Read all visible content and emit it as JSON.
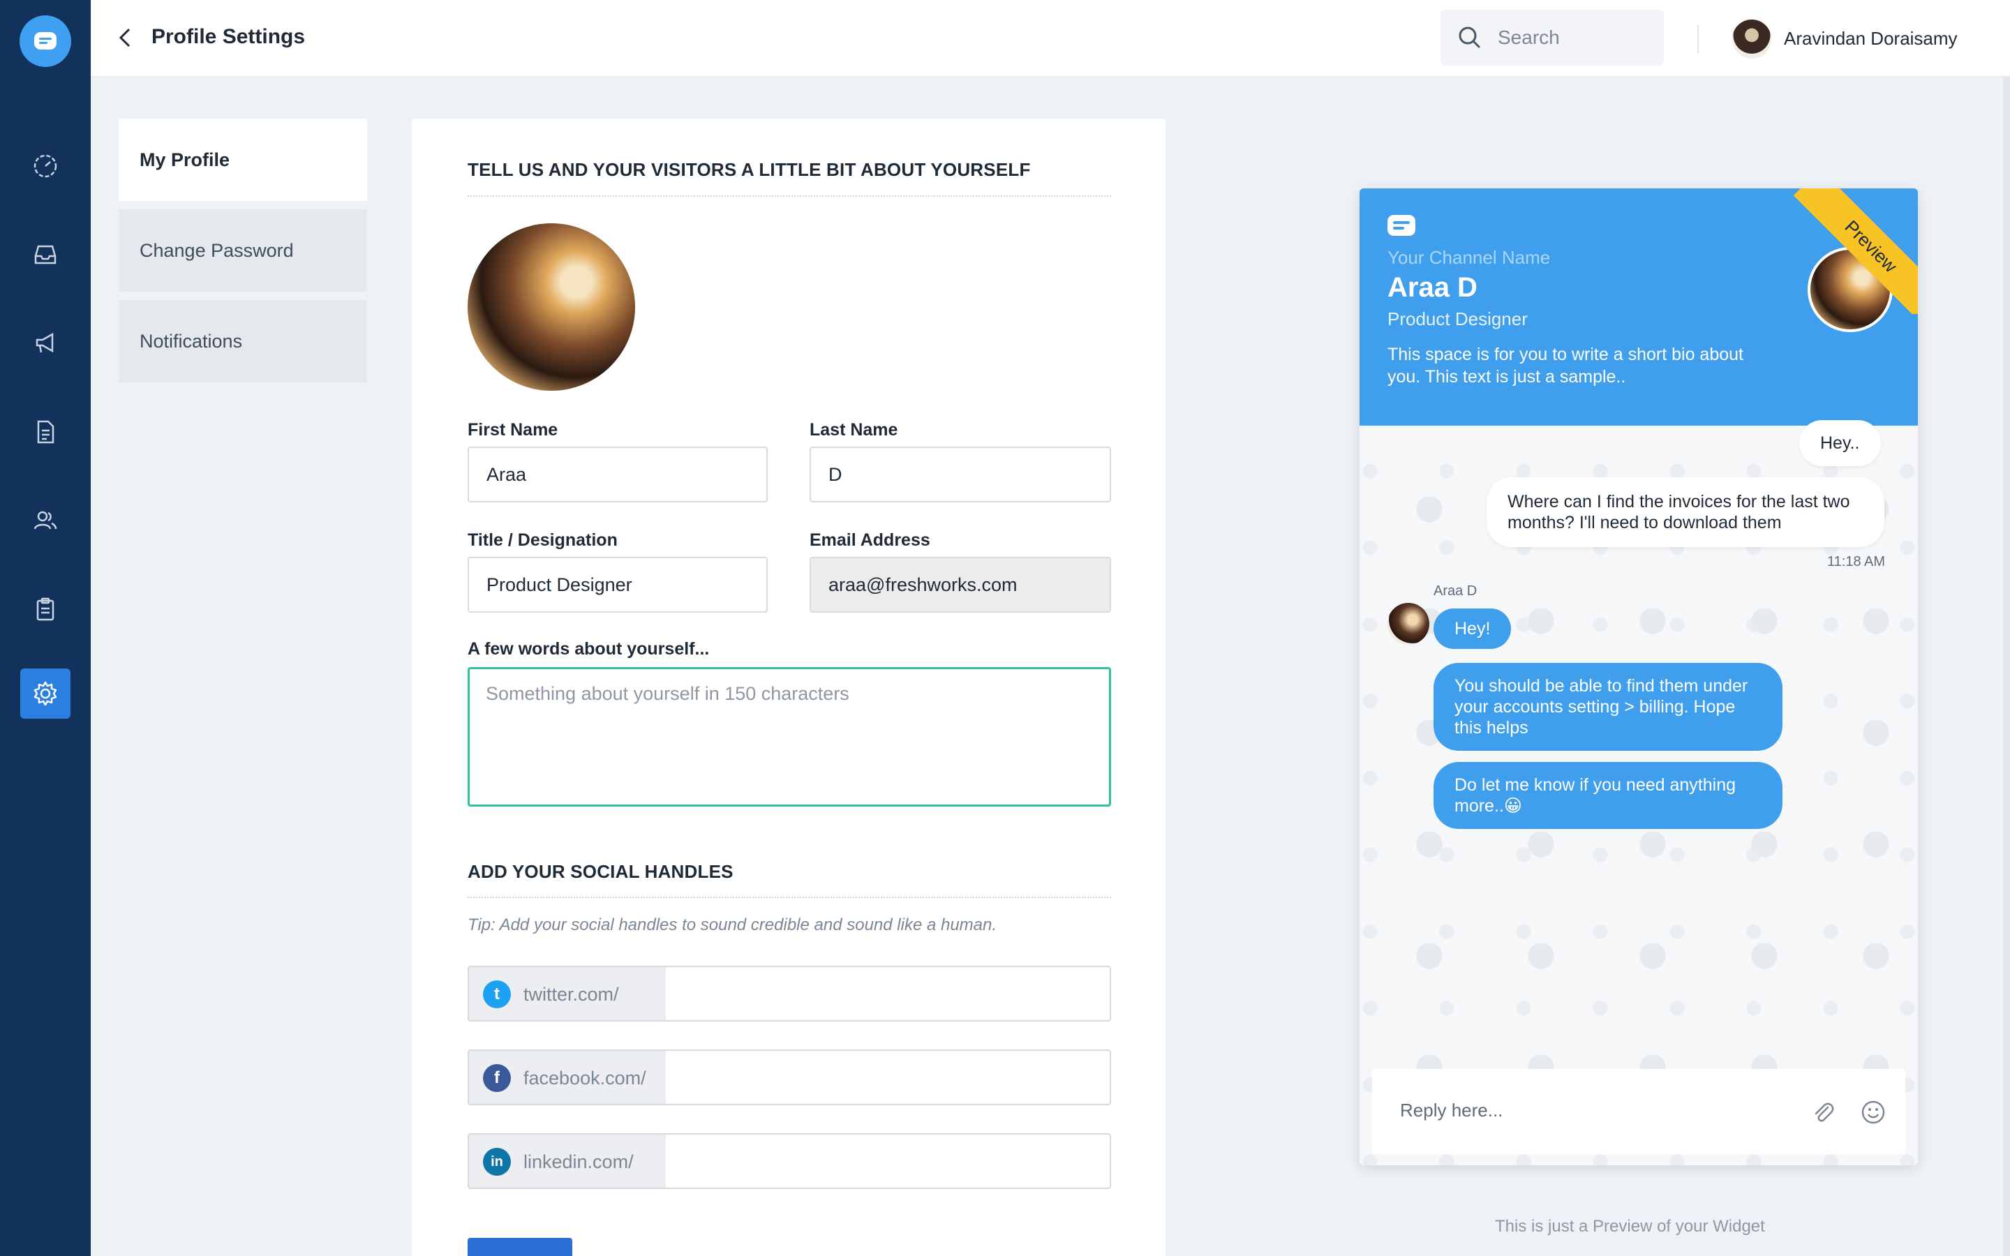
{
  "app": {
    "page_title": "Profile Settings",
    "accent": "#2b7fe0",
    "nav_bg": "#13325b"
  },
  "nav": {
    "items": [
      {
        "icon": "dashboard-icon"
      },
      {
        "icon": "inbox-icon"
      },
      {
        "icon": "megaphone-icon"
      },
      {
        "icon": "document-icon"
      },
      {
        "icon": "contacts-icon"
      },
      {
        "icon": "clipboard-icon"
      },
      {
        "icon": "gear-icon",
        "active": true
      }
    ]
  },
  "header": {
    "search_placeholder": "Search",
    "user_name": "Aravindan Doraisamy"
  },
  "submenu": {
    "items": [
      "My Profile",
      "Change Password",
      "Notifications"
    ],
    "active": "My Profile"
  },
  "form": {
    "section_about": "TELL US AND YOUR VISITORS A LITTLE BIT ABOUT YOURSELF",
    "first_name_label": "First Name",
    "first_name_value": "Araa",
    "last_name_label": "Last Name",
    "last_name_value": "D",
    "title_label": "Title / Designation",
    "title_value": "Product Designer",
    "email_label": "Email Address",
    "email_value": "araa@freshworks.com",
    "about_label": "A few words about yourself...",
    "about_placeholder": "Something about yourself in 150 characters",
    "section_social": "ADD YOUR SOCIAL HANDLES",
    "social_tip": "Tip: Add your social handles to sound credible and sound like a human.",
    "social": [
      {
        "prefix": "twitter.com/",
        "icon": "twitter-icon",
        "color": "#1da1f2",
        "glyph": "t"
      },
      {
        "prefix": "facebook.com/",
        "icon": "facebook-icon",
        "color": "#3b5998",
        "glyph": "f"
      },
      {
        "prefix": "linkedin.com/",
        "icon": "linkedin-icon",
        "color": "#0e76a8",
        "glyph": "in"
      }
    ]
  },
  "widget": {
    "ribbon": "Preview",
    "channel_name": "Your Channel Name",
    "agent_name": "Araa D",
    "agent_role": "Product Designer",
    "bio": "This space is for you to write a short bio about you. This text is just a sample..",
    "messages": {
      "user_1": "Hey..",
      "user_2": "Where can I find the invoices for the last two months? I'll need to download them",
      "time": "11:18 AM",
      "agent_label": "Araa D",
      "agent_1": "Hey!",
      "agent_2": "You should be able to find them under your accounts setting > billing. Hope this helps",
      "agent_3": "Do let me know if you need anything more..😀"
    },
    "reply_placeholder": "Reply here...",
    "note": "This is just a Preview of your Widget",
    "header_color": "#3f9fec",
    "ribbon_color": "#f7c325"
  }
}
